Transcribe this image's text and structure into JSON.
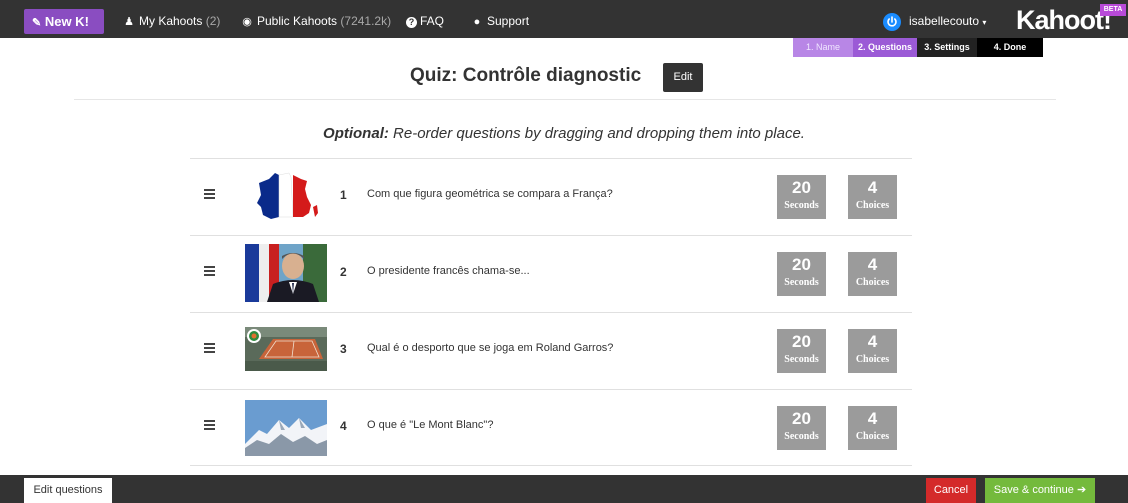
{
  "topbar": {
    "new_label": "New K!",
    "my_kahoots_label": "My Kahoots",
    "my_kahoots_count": "(2)",
    "public_kahoots_label": "Public Kahoots",
    "public_kahoots_count": "(7241.2k)",
    "faq_label": "FAQ",
    "support_label": "Support",
    "user_name": "isabellecouto",
    "brand": "Kahoot!",
    "beta": "BETA"
  },
  "steps": [
    "1. Name",
    "2. Questions",
    "3. Settings",
    "4. Done"
  ],
  "quiz": {
    "title": "Quiz: Contrôle diagnostic",
    "edit_label": "Edit"
  },
  "instruction": {
    "prefix": "Optional:",
    "text": " Re-order questions by dragging and dropping them into place."
  },
  "questions": [
    {
      "number": "1",
      "text": "Com que figura geométrica se compara a França?",
      "seconds": "20",
      "seconds_label": "Seconds",
      "choices": "4",
      "choices_label": "Choices",
      "image": "france-map-flag"
    },
    {
      "number": "2",
      "text": "O presidente francês chama-se...",
      "seconds": "20",
      "seconds_label": "Seconds",
      "choices": "4",
      "choices_label": "Choices",
      "image": "president-photo"
    },
    {
      "number": "3",
      "text": "Qual é o desporto que se joga em Roland Garros?",
      "seconds": "20",
      "seconds_label": "Seconds",
      "choices": "4",
      "choices_label": "Choices",
      "image": "tennis-court-photo"
    },
    {
      "number": "4",
      "text": "O que é \"Le Mont Blanc\"?",
      "seconds": "20",
      "seconds_label": "Seconds",
      "choices": "4",
      "choices_label": "Choices",
      "image": "mountain-photo"
    }
  ],
  "bottombar": {
    "edit_questions_label": "Edit questions",
    "cancel_label": "Cancel",
    "save_label": "Save & continue"
  },
  "colors": {
    "topbar": "#333333",
    "new_button": "#8a4dc1",
    "cancel": "#d42a2a",
    "save": "#74ba3c",
    "badge": "#9b9b9b"
  }
}
